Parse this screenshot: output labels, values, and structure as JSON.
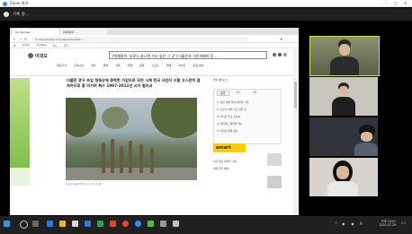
{
  "zoom": {
    "title": "Zoom 회의",
    "window_controls": [
      "–",
      "□",
      "✕"
    ],
    "share_label": "기록 중..."
  },
  "browser": {
    "tabs": [
      "Sin Nomad...",
      "[박재령의 ..."
    ],
    "url": "m.news.imaeil.com/page/view/2020...",
    "bookmarks": [
      "앱",
      "Gmail",
      "YouTube",
      "지도",
      "번역"
    ]
  },
  "site": {
    "logo": "이대오",
    "headline": "[박재령의 '코로나 끝나면 가고 싶은 그 곳'] 더블린과 식민지배의 흔...",
    "nav": [
      "최신기사",
      "오피니언",
      "정치",
      "경제",
      "사회",
      "국제",
      "문화",
      "스포츠",
      "연예",
      "라이프",
      "포토/영상"
    ],
    "article_text": "더블린 광구 포입 청동상에 중력한 가감으로 모든 시체 힌국 사인지 수탈 고스란히 겹쳐하므로 흉 아가며 복수 1997-2011년 서거 벌어서",
    "caption": "더블린 리피강변의 대기근 추모 조각상",
    "sidebar_title": "많이 본 뉴스",
    "sidebar_tabs": [
      "종합",
      "정치",
      "사회"
    ],
    "sidebar_items": [
      "1. 식민 지배 역사 더블린 기행",
      "2. 코로나 이후 가고 싶은 곳",
      "3. 대기근 추모 조각상",
      "4. 아일랜드 독립의 역사",
      "5. 더블린 여행 정보"
    ],
    "ad_brand": "emart",
    "ad_text_lines": [
      "지금 바로 온라인 구매",
      "최대 할인 혜택"
    ]
  },
  "participants": [
    {
      "name": ""
    },
    {
      "name": ""
    },
    {
      "name": ""
    },
    {
      "name": ""
    }
  ],
  "taskbar": {
    "time": "오후 10:01",
    "date": "2020-07-29",
    "lang": "A"
  },
  "colors": {
    "zoom_blue": "#2d8cff",
    "active_speaker": "#c9e34a",
    "taskbar": "#202020"
  }
}
